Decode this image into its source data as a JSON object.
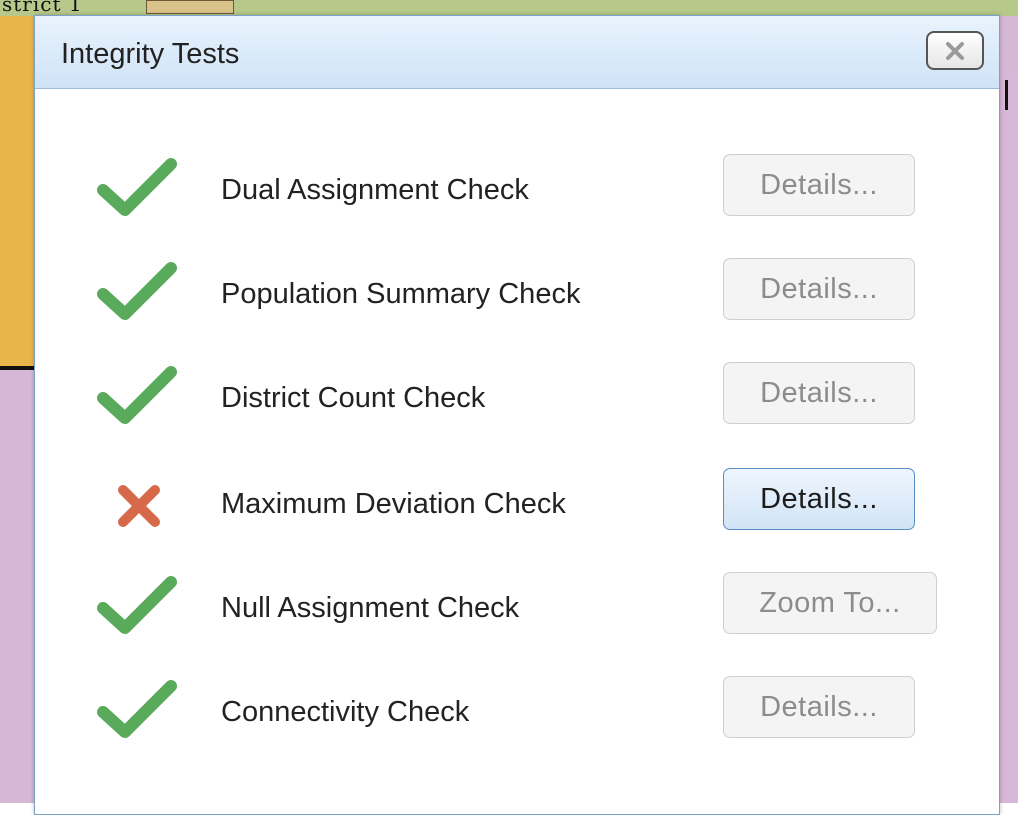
{
  "background": {
    "district_label": "strict 1"
  },
  "dialog": {
    "title": "Integrity Tests",
    "close_label": "X"
  },
  "tests": [
    {
      "label": "Dual Assignment Check",
      "status": "pass",
      "button": "Details...",
      "button_enabled": false
    },
    {
      "label": "Population Summary Check",
      "status": "pass",
      "button": "Details...",
      "button_enabled": false
    },
    {
      "label": "District Count Check",
      "status": "pass",
      "button": "Details...",
      "button_enabled": false
    },
    {
      "label": "Maximum Deviation Check",
      "status": "fail",
      "button": "Details...",
      "button_enabled": true
    },
    {
      "label": "Null Assignment Check",
      "status": "pass",
      "button": "Zoom To...",
      "button_enabled": false
    },
    {
      "label": "Connectivity Check",
      "status": "pass",
      "button": "Details...",
      "button_enabled": false
    }
  ],
  "colors": {
    "pass": "#5aaa5c",
    "fail": "#d5694a",
    "header_top": "#e9f3fd",
    "header_bottom": "#cfe3f7"
  },
  "icons": {
    "pass": "check-icon",
    "fail": "cross-icon",
    "close": "close-icon"
  }
}
